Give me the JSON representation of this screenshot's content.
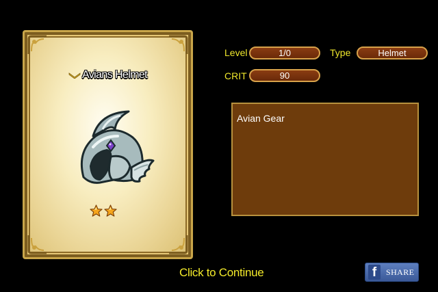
{
  "item": {
    "name": "Avians Helmet",
    "stars": 2,
    "description": "Avian Gear"
  },
  "stats": {
    "level_label": "Level",
    "level_value": "1/0",
    "type_label": "Type",
    "type_value": "Helmet",
    "crit_label": "CRIT",
    "crit_value": "90"
  },
  "footer": {
    "continue_label": "Click to Continue",
    "share_label": "SHARE",
    "facebook_glyph": "f"
  },
  "icons": {
    "rank": "chevron-rank-icon",
    "item": "helmet-icon",
    "star": "star-icon",
    "facebook": "facebook-icon"
  },
  "colors": {
    "label_yellow": "#f0e82c",
    "pill_brown": "#7a3410",
    "box_brown": "#6e3c0c",
    "facebook_blue": "#3b5998"
  }
}
